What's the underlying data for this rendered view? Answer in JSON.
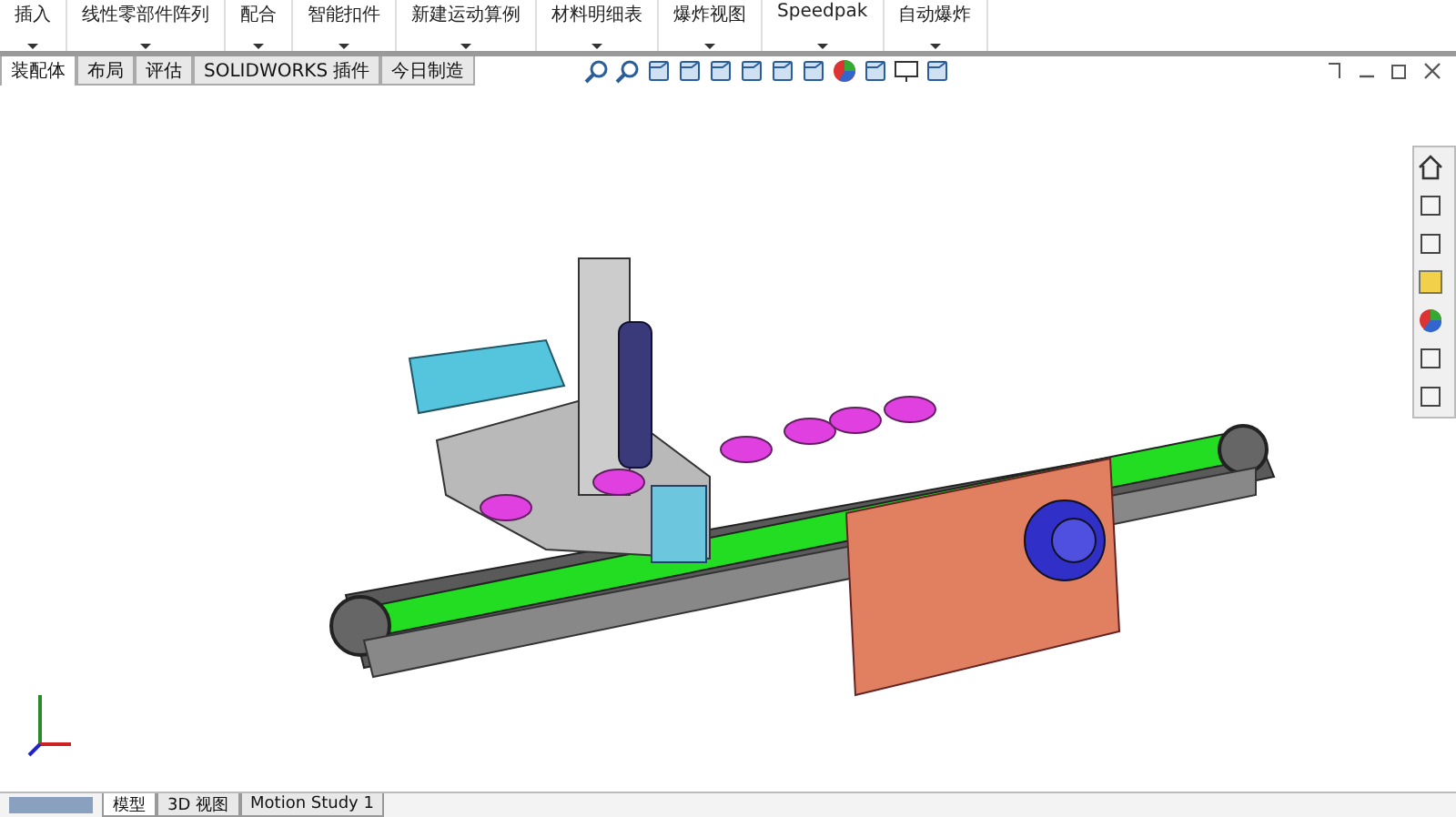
{
  "ribbon": {
    "groups": [
      {
        "label": "插入"
      },
      {
        "label": "线性零部件阵列"
      },
      {
        "label": "配合"
      },
      {
        "label": "智能扣件"
      },
      {
        "label": "新建运动算例"
      },
      {
        "label": "材料明细表"
      },
      {
        "label": "爆炸视图"
      },
      {
        "label": "Speedpak"
      },
      {
        "label": "自动爆炸"
      }
    ]
  },
  "tabs": [
    {
      "label": "装配体",
      "selected": true
    },
    {
      "label": "布局",
      "selected": false
    },
    {
      "label": "评估",
      "selected": false
    },
    {
      "label": "SOLIDWORKS 插件",
      "selected": false
    },
    {
      "label": "今日制造",
      "selected": false
    }
  ],
  "bottom_tabs": [
    {
      "label": "模型",
      "selected": true
    },
    {
      "label": "3D 视图",
      "selected": false
    },
    {
      "label": "Motion Study 1",
      "selected": false
    }
  ]
}
